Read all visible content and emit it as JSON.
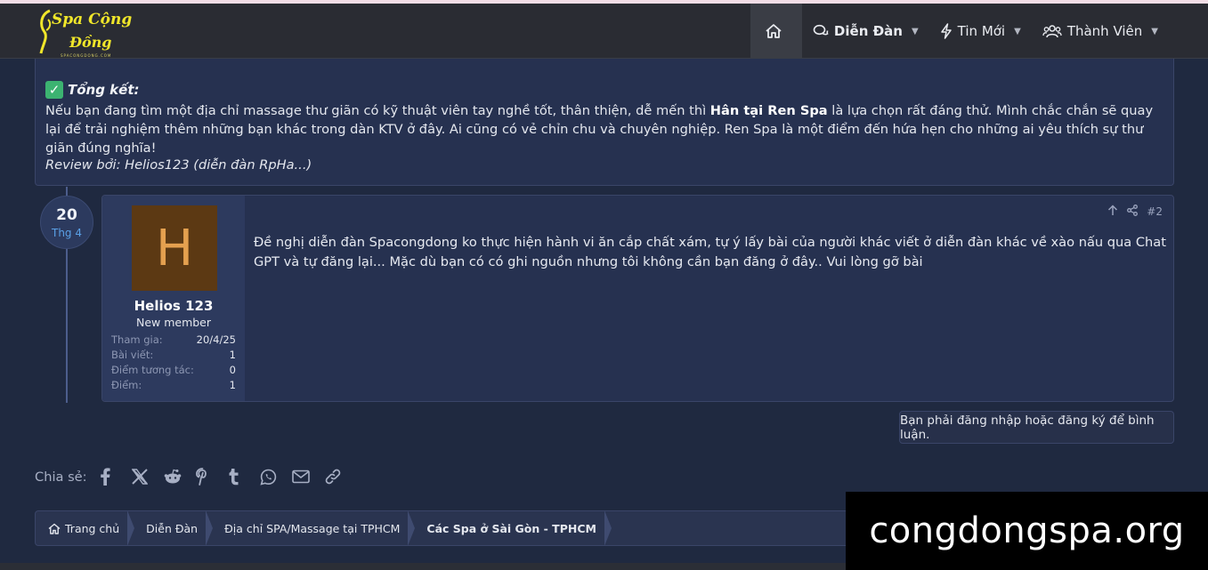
{
  "header": {
    "logo_line1": "Spa Cộng",
    "logo_line2": "Đồng",
    "logo_line3": "SPACONGDONG.COM",
    "nav": [
      {
        "label": "",
        "icon": "home-icon"
      },
      {
        "label": "Diễn Đàn",
        "icon": "chat-icon"
      },
      {
        "label": "Tin Mới",
        "icon": "bolt-icon"
      },
      {
        "label": "Thành Viên",
        "icon": "users-icon"
      }
    ]
  },
  "post1": {
    "summary_title": "Tổng kết:",
    "text_part1": "Nếu bạn đang tìm một địa chỉ massage thư giãn có kỹ thuật viên tay nghề tốt, thân thiện, dễ mến thì ",
    "text_bold": "Hân tại Ren Spa",
    "text_part2": " là lựa chọn rất đáng thử. Mình chắc chắn sẽ quay lại để trải nghiệm thêm những bạn khác trong dàn KTV ở đây. Ai cũng có vẻ chỉn chu và chuyên nghiệp. Ren Spa là một điểm đến hứa hẹn cho những ai yêu thích sự thư giãn đúng nghĩa!",
    "review": "Review bởi: Helios123 (diễn đàn RpHa...)"
  },
  "date": {
    "day": "20",
    "month": "Thg 4"
  },
  "reply": {
    "avatar_letter": "H",
    "username": "Helios 123",
    "user_title": "New member",
    "stats": [
      {
        "label": "Tham gia:",
        "value": "20/4/25"
      },
      {
        "label": "Bài viết:",
        "value": "1"
      },
      {
        "label": "Điểm tương tác:",
        "value": "0"
      },
      {
        "label": "Điểm:",
        "value": "1"
      }
    ],
    "post_number": "#2",
    "text": "Đề nghị diễn đàn Spacongdong ko thực hiện hành vi ăn cắp chất xám, tự ý lấy bài của người khác viết ở diễn đàn khác về xào nấu qua Chat GPT và tự đăng lại... Mặc dù bạn có có ghi nguồn nhưng tôi không cần bạn đăng ở đây.. Vui lòng gỡ bài"
  },
  "login_prompt": "Bạn phải đăng nhập hoặc đăng ký để bình luận.",
  "share": {
    "label": "Chia sẻ:",
    "icons": [
      "facebook-icon",
      "x-icon",
      "reddit-icon",
      "pinterest-icon",
      "tumblr-icon",
      "whatsapp-icon",
      "email-icon",
      "link-icon"
    ]
  },
  "breadcrumb": [
    "Trang chủ",
    "Diễn Đàn",
    "Địa chỉ SPA/Massage tại TPHCM",
    "Các Spa ở Sài Gòn - TPHCM"
  ],
  "watermark": "congdongspa.org",
  "colors": {
    "accent": "#5aa0e6",
    "logo": "#f0e62a",
    "avatar_bg": "#5c3913"
  }
}
